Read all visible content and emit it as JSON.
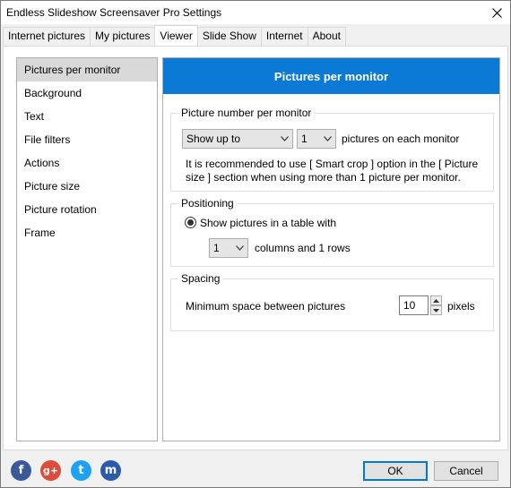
{
  "window": {
    "title": "Endless Slideshow Screensaver Pro Settings"
  },
  "tabs": [
    {
      "label": "Internet pictures"
    },
    {
      "label": "My pictures"
    },
    {
      "label": "Viewer"
    },
    {
      "label": "Slide Show"
    },
    {
      "label": "Internet"
    },
    {
      "label": "About"
    }
  ],
  "sidebar": {
    "items": [
      {
        "label": "Pictures per monitor"
      },
      {
        "label": "Background"
      },
      {
        "label": "Text"
      },
      {
        "label": "File filters"
      },
      {
        "label": "Actions"
      },
      {
        "label": "Picture size"
      },
      {
        "label": "Picture rotation"
      },
      {
        "label": "Frame"
      }
    ]
  },
  "main": {
    "header": "Pictures per monitor",
    "picture_number": {
      "legend": "Picture number per monitor",
      "mode_select": "Show up to",
      "count_select": "1",
      "suffix": "pictures on each monitor",
      "note_line1": "It is recommended to use [ Smart crop ] option in the [ Picture",
      "note_line2": "size ] section when using more than 1 picture per monitor."
    },
    "positioning": {
      "legend": "Positioning",
      "radio_label": "Show pictures in a table with",
      "columns_select": "1",
      "columns_suffix": "columns and 1 rows"
    },
    "spacing": {
      "legend": "Spacing",
      "label": "Minimum space between pictures",
      "value": "10",
      "unit": "pixels"
    }
  },
  "footer": {
    "ok_label": "OK",
    "cancel_label": "Cancel",
    "social": [
      {
        "icon": "facebook-icon",
        "glyph": "f",
        "color": "#3b5998"
      },
      {
        "icon": "google-plus-icon",
        "glyph": "g+",
        "color": "#dd4b39"
      },
      {
        "icon": "twitter-icon",
        "glyph": "t",
        "color": "#1da1f2"
      },
      {
        "icon": "myspace-icon",
        "glyph": "m",
        "color": "#2a5aa8"
      }
    ]
  },
  "colors": {
    "accent": "#0a7ad6",
    "primary_button_border": "#0078d7"
  }
}
